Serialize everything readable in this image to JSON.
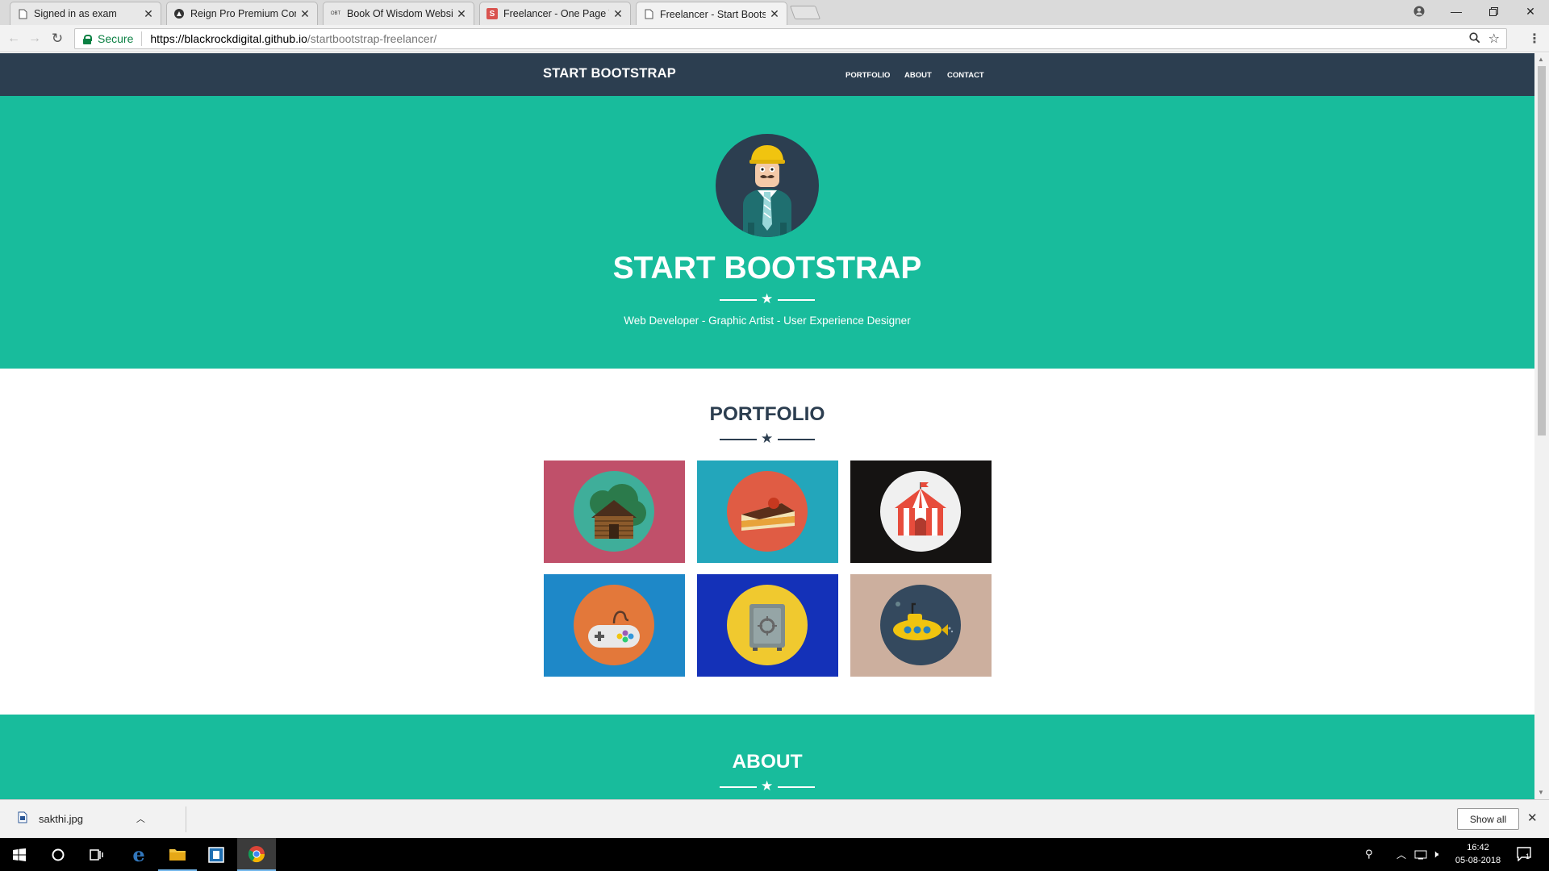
{
  "browser": {
    "tabs": [
      {
        "title": "Signed in as exam",
        "favicon": "page-icon"
      },
      {
        "title": "Reign Pro Premium Corp",
        "favicon": "reign-icon"
      },
      {
        "title": "Book Of Wisdom Website",
        "favicon": "obt-icon",
        "favicon_text": "OBT"
      },
      {
        "title": "Freelancer - One Page Th",
        "favicon": "s-icon",
        "favicon_text": "S"
      },
      {
        "title": "Freelancer - Start Bootstr",
        "favicon": "page-icon"
      }
    ],
    "secure_label": "Secure",
    "url_host": "https://blackrockdigital.github.io",
    "url_path": "/startbootstrap-freelancer/"
  },
  "site": {
    "brand": "START BOOTSTRAP",
    "nav": [
      "PORTFOLIO",
      "ABOUT",
      "CONTACT"
    ],
    "hero_title": "START BOOTSTRAP",
    "hero_subtitle": "Web Developer - Graphic Artist - User Experience Designer",
    "portfolio_title": "PORTFOLIO",
    "portfolio_items": [
      {
        "name": "cabin",
        "bg": "#c0506a",
        "circle": "#3fae9a"
      },
      {
        "name": "cake",
        "bg": "#23a6bb",
        "circle": "#e05c44"
      },
      {
        "name": "circus",
        "bg": "#151312",
        "circle": "#f0f0f0"
      },
      {
        "name": "game",
        "bg": "#1e88c8",
        "circle": "#e3783a"
      },
      {
        "name": "safe",
        "bg": "#1431b8",
        "circle": "#f0c92f"
      },
      {
        "name": "submarine",
        "bg": "#ccaf9e",
        "circle": "#34495e"
      }
    ],
    "about_title": "ABOUT"
  },
  "downloads": {
    "file": "sakthi.jpg",
    "show_all": "Show all"
  },
  "taskbar": {
    "time": "16:42",
    "date": "05-08-2018",
    "notifications": "1"
  },
  "colors": {
    "primary": "#2c3e50",
    "accent": "#18bc9c"
  }
}
